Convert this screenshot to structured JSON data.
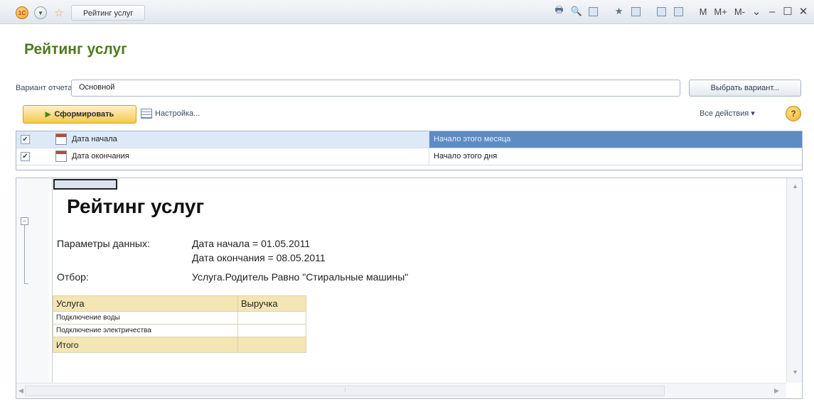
{
  "window": {
    "tab_title": "Рейтинг услуг",
    "logo_text": "1С",
    "memory_buttons": [
      "M",
      "M+",
      "M-"
    ]
  },
  "page": {
    "title": "Рейтинг услуг"
  },
  "variant": {
    "label": "Вариант отчета:",
    "value": "Основной",
    "choose_button": "Выбрать вариант..."
  },
  "toolbar": {
    "generate_button": "Сформировать",
    "settings_button": "Настройка...",
    "all_actions": "Все действия ▾",
    "help": "?"
  },
  "parameters": [
    {
      "name": "Дата начала",
      "value": "Начало этого месяца",
      "checked": true
    },
    {
      "name": "Дата окончания",
      "value": "Начало этого дня",
      "checked": true
    }
  ],
  "report": {
    "title": "Рейтинг услуг",
    "params_label": "Параметры данных:",
    "param_line1": "Дата начала = 01.05.2011",
    "param_line2": "Дата окончания = 08.05.2011",
    "filter_label": "Отбор:",
    "filter_value": "Услуга.Родитель Равно \"Стиральные машины\"",
    "table": {
      "headers": [
        "Услуга",
        "Выручка"
      ],
      "rows": [
        [
          "Подключение воды",
          ""
        ],
        [
          "Подключение электричества",
          ""
        ]
      ],
      "total_label": "Итого"
    }
  },
  "colors": {
    "title_green": "#4e7a1c",
    "selected_row": "#5d8cc3",
    "table_header": "#f4e6b4"
  }
}
